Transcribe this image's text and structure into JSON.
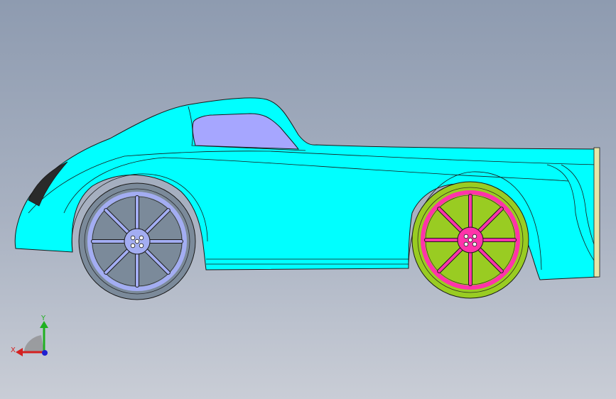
{
  "viewport": {
    "background_top": "#8e9bb0",
    "background_bottom": "#c9cdd6"
  },
  "model": {
    "body_color": "#00ffff",
    "window_color": "#a6a6ff",
    "front_wheel": {
      "rim_color": "#a3adf2",
      "tire_color": "#7b8a9a"
    },
    "rear_wheel": {
      "rim_color": "#ff33aa",
      "tire_color": "#99cc22"
    },
    "spoke_count": 8,
    "edge_color": "#1a1a1a"
  },
  "triad": {
    "x_label": "X",
    "y_label": "Y",
    "x_color": "#d42020",
    "y_color": "#20b020",
    "z_color": "#2020d0"
  }
}
